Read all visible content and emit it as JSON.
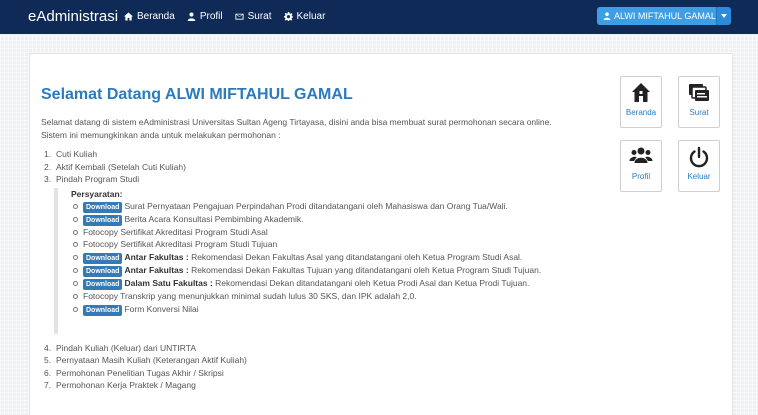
{
  "navbar": {
    "brand": "eAdministrasi",
    "links": [
      {
        "label": "Beranda",
        "icon": "home-icon"
      },
      {
        "label": "Profil",
        "icon": "user-icon"
      },
      {
        "label": "Surat",
        "icon": "envelope-icon"
      },
      {
        "label": "Keluar",
        "icon": "gear-icon"
      }
    ],
    "user_button": "ALWI MIFTAHUL GAMAL"
  },
  "main": {
    "title": "Selamat Datang ALWI MIFTAHUL GAMAL",
    "intro": [
      "Selamat datang di sistem eAdministrasi Universitas Sultan Ageng Tirtayasa, disini anda bisa membuat surat permohonan secara online.",
      "Sistem ini memungkinkan anda untuk melakukan permohonan :"
    ],
    "items_before": [
      {
        "num": "1.",
        "label": "Cuti Kuliah"
      },
      {
        "num": "2.",
        "label": "Aktif Kembali (Setelah Cuti Kuliah)"
      },
      {
        "num": "3.",
        "label": "Pindah Program Studi"
      }
    ],
    "requirements_title": "Persyaratan:",
    "download_label": "Download",
    "requirements": [
      {
        "bold": "",
        "text": "Surat Pernyataan Pengajuan Perpindahan Prodi ditandatangani oleh Mahasiswa dan Orang Tua/Wali."
      },
      {
        "bold": "",
        "text": "Berita Acara Konsultasi Pembimbing Akademik."
      },
      {
        "bold": "",
        "text": "Fotocopy Sertifikat Akreditasi Program Studi Asal"
      },
      {
        "bold": "",
        "text": "Fotocopy Sertifikat Akreditasi Program Studi Tujuan"
      },
      {
        "bold": "Antar Fakultas :",
        "text": " Rekomendasi Dekan Fakultas Asal yang ditandatangani oleh Ketua Program Studi Asal."
      },
      {
        "bold": "Antar Fakultas :",
        "text": " Rekomendasi Dekan Fakultas Tujuan yang ditandatangani oleh Ketua Program Studi Tujuan."
      },
      {
        "bold": "Dalam Satu Fakultas :",
        "text": " Rekomendasi Dekan ditandatangani oleh Ketua Prodi Asal dan Ketua Prodi Tujuan."
      },
      {
        "bold": "",
        "text": "Fotocopy Transkrip yang menunjukkan minimal sudah lulus 30 SKS, dan IPK adalah 2,0."
      },
      {
        "bold": "",
        "text": "Form Konversi Nilai"
      }
    ],
    "items_after": [
      {
        "num": "4.",
        "label": "Pindah Kuliah (Keluar) dari UNTIRTA"
      },
      {
        "num": "5.",
        "label": "Pernyataan Masih Kuliah (Keterangan Aktif Kuliah)"
      },
      {
        "num": "6.",
        "label": "Permohonan Penelitian Tugas Akhir / Skripsi"
      },
      {
        "num": "7.",
        "label": "Permohonan Kerja Praktek / Magang"
      }
    ]
  },
  "tiles": [
    {
      "label": "Beranda",
      "icon": "home-icon"
    },
    {
      "label": "Surat",
      "icon": "documents-icon"
    },
    {
      "label": "Profil",
      "icon": "users-icon"
    },
    {
      "label": "Keluar",
      "icon": "power-icon"
    }
  ],
  "colors": {
    "navbar": "#0f2a57",
    "accent": "#2b7bbf",
    "button": "#3d9ee6",
    "download_badge": "#337ab7"
  }
}
